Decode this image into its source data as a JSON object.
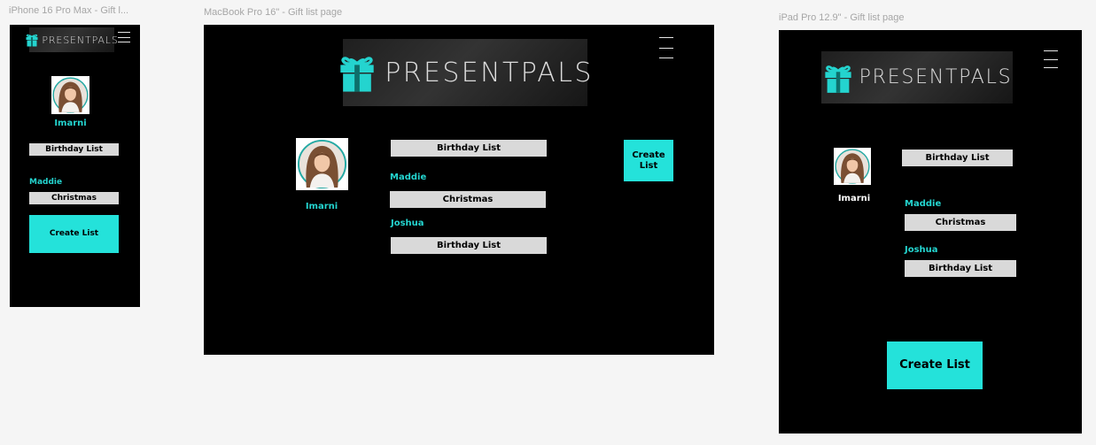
{
  "frames": {
    "phone": {
      "label": "iPhone 16 Pro Max - Gift l..."
    },
    "desktop": {
      "label": "MacBook Pro 16\" - Gift list page"
    },
    "tablet": {
      "label": "iPad Pro 12.9\" - Gift list page"
    }
  },
  "brand": {
    "logo_text": "PRESENTPALS",
    "icon": "gift-icon",
    "accent": "#24d4cf",
    "button_color": "#24e2da"
  },
  "menu": {
    "icon": "hamburger-menu-icon"
  },
  "user": {
    "name": "Imarni",
    "avatar_icon": "profile-photo"
  },
  "lists": {
    "own": "Birthday List",
    "shared": [
      {
        "owner": "Maddie",
        "title": "Christmas"
      },
      {
        "owner": "Joshua",
        "title": "Birthday List"
      }
    ]
  },
  "actions": {
    "create_list": "Create List"
  }
}
